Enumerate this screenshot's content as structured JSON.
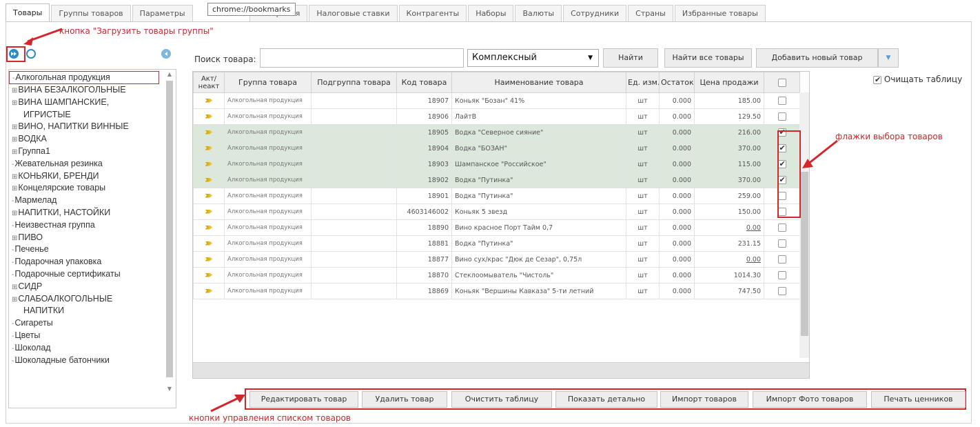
{
  "tabs": [
    "Товары",
    "Группы товаров",
    "Параметры",
    "измерения",
    "Налоговые ставки",
    "Контрагенты",
    "Наборы",
    "Валюты",
    "Сотрудники",
    "Страны",
    "Избранные товары"
  ],
  "tooltip_url": "chrome://bookmarks",
  "annotations": {
    "load_button": "кнопка \"Загрузить товары группы\"",
    "checkboxes": "флажки выбора товаров",
    "list_buttons": "кнопки управления списком товаров"
  },
  "tree": [
    {
      "label": "Алкогольная продукция",
      "prefix": "",
      "upper": false,
      "selected": true
    },
    {
      "label": "ВИНА БЕЗАЛКОГОЛЬНЫЕ",
      "prefix": "+",
      "upper": true
    },
    {
      "label": "ВИНА ШАМПАНСКИЕ,",
      "prefix": "+",
      "upper": true
    },
    {
      "label": "ИГРИСТЫЕ",
      "prefix": "",
      "upper": true,
      "indent": true
    },
    {
      "label": "ВИНО, НАПИТКИ ВИННЫЕ",
      "prefix": "+",
      "upper": true
    },
    {
      "label": "ВОДКА",
      "prefix": "+",
      "upper": true
    },
    {
      "label": "Группа1",
      "prefix": "+",
      "upper": false
    },
    {
      "label": "Жевательная резинка",
      "prefix": "",
      "upper": false
    },
    {
      "label": "КОНЬЯКИ, БРЕНДИ",
      "prefix": "+",
      "upper": true
    },
    {
      "label": "Концелярские товары",
      "prefix": "+",
      "upper": false
    },
    {
      "label": "Мармелад",
      "prefix": "",
      "upper": false
    },
    {
      "label": "НАПИТКИ, НАСТОЙКИ",
      "prefix": "+",
      "upper": true
    },
    {
      "label": "Неизвестная группа",
      "prefix": "",
      "upper": false
    },
    {
      "label": "ПИВО",
      "prefix": "+",
      "upper": true
    },
    {
      "label": "Печенье",
      "prefix": "",
      "upper": false
    },
    {
      "label": "Подарочная упаковка",
      "prefix": "",
      "upper": false
    },
    {
      "label": "Подарочные сертификаты",
      "prefix": "",
      "upper": false
    },
    {
      "label": "СИДР",
      "prefix": "+",
      "upper": true
    },
    {
      "label": "СЛАБОАЛКОГОЛЬНЫЕ",
      "prefix": "+",
      "upper": true
    },
    {
      "label": "НАПИТКИ",
      "prefix": "",
      "upper": true,
      "indent": true
    },
    {
      "label": "Сигареты",
      "prefix": "",
      "upper": false
    },
    {
      "label": "Цветы",
      "prefix": "",
      "upper": false
    },
    {
      "label": "Шоколад",
      "prefix": "",
      "upper": false
    },
    {
      "label": "Шоколадные батончики",
      "prefix": "",
      "upper": false
    }
  ],
  "search": {
    "label": "Поиск товара:",
    "value": "",
    "mode": "Комплексный",
    "find": "Найти",
    "find_all": "Найти все товары",
    "add_new": "Добавить новый товар",
    "clear_table": "Очищать таблицу",
    "clear_table_checked": true
  },
  "table": {
    "headers": [
      "Акт/ неакт",
      "Группа товара",
      "Подгруппа товара",
      "Код товара",
      "Наименование товара",
      "Ед. изм.",
      "Остаток",
      "Цена продажи"
    ],
    "rows": [
      {
        "group": "Алкогольная продукция",
        "sub": "",
        "code": "18907",
        "name": "Коньяк \"Бозан\" 41%",
        "unit": "шт",
        "stock": "0.000",
        "price": "185.00",
        "checked": false,
        "sel": false,
        "u": false
      },
      {
        "group": "Алкогольная продукция",
        "sub": "",
        "code": "18906",
        "name": "ЛайтВ",
        "unit": "шт",
        "stock": "0.000",
        "price": "129.50",
        "checked": false,
        "sel": false,
        "u": false
      },
      {
        "group": "Алкогольная продукция",
        "sub": "",
        "code": "18905",
        "name": "Водка \"Северное сияние\"",
        "unit": "шт",
        "stock": "0.000",
        "price": "216.00",
        "checked": true,
        "sel": true,
        "u": false
      },
      {
        "group": "Алкогольная продукция",
        "sub": "",
        "code": "18904",
        "name": "Водка \"БОЗАН\"",
        "unit": "шт",
        "stock": "0.000",
        "price": "370.00",
        "checked": true,
        "sel": true,
        "u": false
      },
      {
        "group": "Алкогольная продукция",
        "sub": "",
        "code": "18903",
        "name": "Шампанское \"Российское\"",
        "unit": "шт",
        "stock": "0.000",
        "price": "115.00",
        "checked": true,
        "sel": true,
        "u": false
      },
      {
        "group": "Алкогольная продукция",
        "sub": "",
        "code": "18902",
        "name": "Водка \"Путинка\"",
        "unit": "шт",
        "stock": "0.000",
        "price": "370.00",
        "checked": true,
        "sel": true,
        "u": false
      },
      {
        "group": "Алкогольная продукция",
        "sub": "",
        "code": "18901",
        "name": "Водка \"Путинка\"",
        "unit": "шт",
        "stock": "0.000",
        "price": "259.00",
        "checked": false,
        "sel": false,
        "u": false
      },
      {
        "group": "Алкогольная продукция",
        "sub": "",
        "code": "4603146002",
        "name": "Коньяк 5 звезд",
        "unit": "шт",
        "stock": "0.000",
        "price": "150.00",
        "checked": false,
        "sel": false,
        "u": false
      },
      {
        "group": "Алкогольная продукция",
        "sub": "",
        "code": "18890",
        "name": "Вино красное Порт Тайм 0,7",
        "unit": "шт",
        "stock": "0.000",
        "price": "0.00",
        "checked": false,
        "sel": false,
        "u": true
      },
      {
        "group": "Алкогольная продукция",
        "sub": "",
        "code": "18881",
        "name": "Водка \"Путинка\"",
        "unit": "шт",
        "stock": "0.000",
        "price": "231.15",
        "checked": false,
        "sel": false,
        "u": false
      },
      {
        "group": "Алкогольная продукция",
        "sub": "",
        "code": "18877",
        "name": "Вино сух/крас \"Дюк де Сезар\", 0,75л",
        "unit": "шт",
        "stock": "0.000",
        "price": "0.00",
        "checked": false,
        "sel": false,
        "u": true
      },
      {
        "group": "Алкогольная продукция",
        "sub": "",
        "code": "18870",
        "name": "Стеклоомыватель \"Чистоль\"",
        "unit": "шт",
        "stock": "0.000",
        "price": "1014.30",
        "checked": false,
        "sel": false,
        "u": false
      },
      {
        "group": "Алкогольная продукция",
        "sub": "",
        "code": "18869",
        "name": "Коньяк \"Вершины Кавказа\" 5-ти летний",
        "unit": "шт",
        "stock": "0.000",
        "price": "747.50",
        "checked": false,
        "sel": false,
        "u": false
      }
    ]
  },
  "bottom_buttons": [
    "Редактировать товар",
    "Удалить товар",
    "Очистить таблицу",
    "Показать детально",
    "Импорт товаров",
    "Импорт Фото товаров",
    "Печать ценников"
  ],
  "colors": {
    "annotation": "#d1262b",
    "selected_row": "#dde8dd",
    "dropdown_arrow": "#5b9bd5"
  }
}
